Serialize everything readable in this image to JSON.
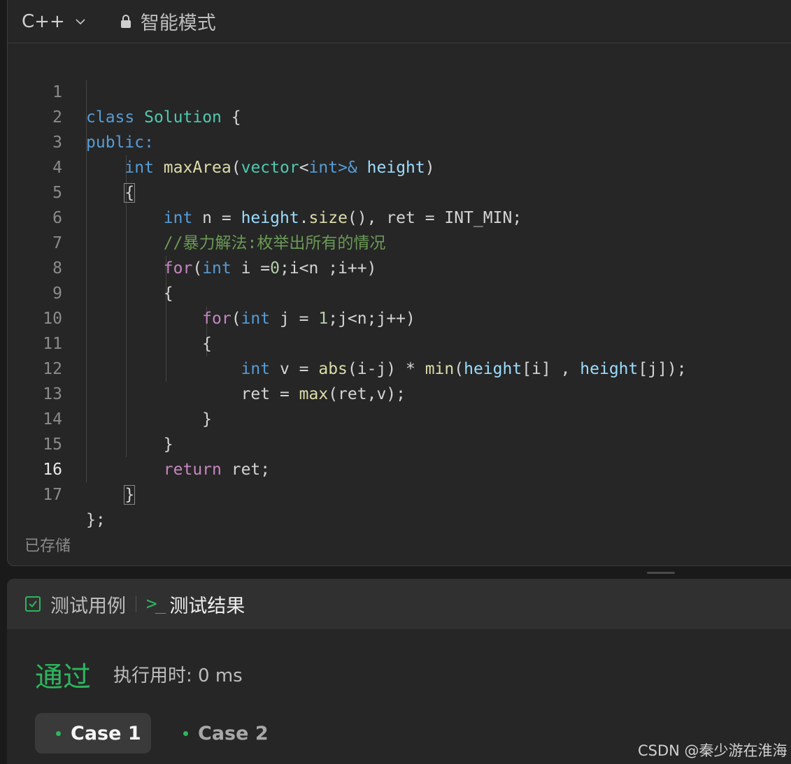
{
  "toolbar": {
    "language": "C++",
    "mode": "智能模式"
  },
  "editor": {
    "line_numbers": [
      "1",
      "2",
      "3",
      "4",
      "5",
      "6",
      "7",
      "8",
      "9",
      "10",
      "11",
      "12",
      "13",
      "14",
      "15",
      "16",
      "17"
    ],
    "current_line": "16",
    "code": {
      "l1": [
        "class",
        "Solution",
        " {"
      ],
      "l2": [
        "public:"
      ],
      "l3": [
        "int",
        "maxArea",
        "(",
        "vector",
        "<",
        "int",
        ">&",
        " ",
        "height",
        ")"
      ],
      "l4": [
        "{"
      ],
      "l5": [
        "int",
        " n = ",
        "height",
        ".",
        "size",
        "(), ret = INT_MIN;"
      ],
      "l6": [
        "//暴力解法:枚举出所有的情况"
      ],
      "l7": [
        "for",
        "(",
        "int",
        " i =",
        "0",
        ";i<n ;i++)"
      ],
      "l8": [
        "{"
      ],
      "l9": [
        "for",
        "(",
        "int",
        " j = ",
        "1",
        ";j<n;j++)"
      ],
      "l10": [
        "{"
      ],
      "l11": [
        "int",
        " v = ",
        "abs",
        "(i-j) * ",
        "min",
        "(",
        "height",
        "[i] , ",
        "height",
        "[j]);"
      ],
      "l12": [
        "ret = ",
        "max",
        "(ret,v);"
      ],
      "l13": [
        "}"
      ],
      "l14": [
        "}"
      ],
      "l15": [
        "return",
        " ret;"
      ],
      "l16": [
        "}"
      ],
      "l17": [
        "};"
      ]
    },
    "save_status": "已存储"
  },
  "results": {
    "tab_testcase": "测试用例",
    "tab_result": "测试结果",
    "status": "通过",
    "runtime": "执行用时: 0 ms",
    "cases": [
      "Case 1",
      "Case 2"
    ]
  },
  "watermark": "CSDN @秦少游在淮海",
  "colors": {
    "accent_green": "#2db55d",
    "keyword": "#569cd6",
    "control": "#c586c0"
  }
}
